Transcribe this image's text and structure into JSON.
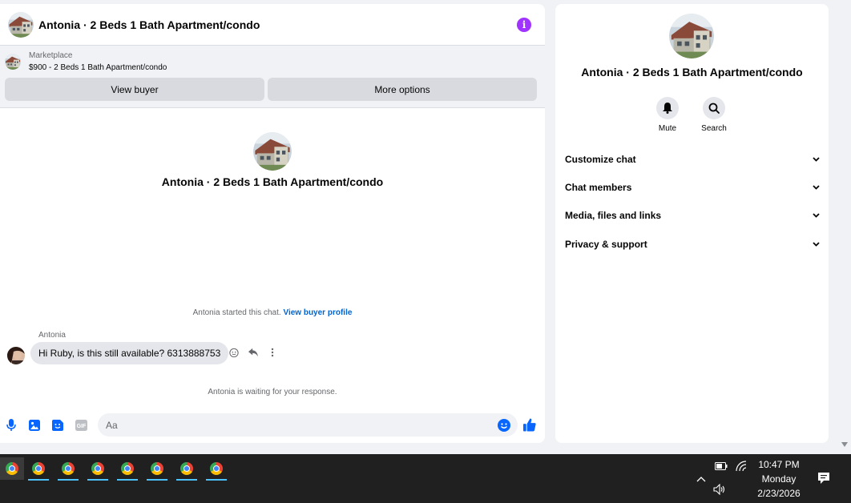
{
  "chat": {
    "title": "Antonia · 2 Beds 1 Bath Apartment/condo",
    "info_glyph": "i",
    "marketplace_label": "Marketplace",
    "listing": "$900 - 2 Beds 1 Bath Apartment/condo",
    "view_buyer_label": "View buyer",
    "more_options_label": "More options",
    "profile_name": "Antonia · 2 Beds 1 Bath Apartment/condo",
    "started_text": "Antonia started this chat.",
    "view_buyer_profile_link": "View buyer profile",
    "sender": "Antonia",
    "message": "Hi Ruby, is this still available? 6313888753",
    "waiting_text": "Antonia is waiting for your response.",
    "input_placeholder": "Aa"
  },
  "info_panel": {
    "name": "Antonia · 2 Beds 1 Bath Apartment/condo",
    "mute_label": "Mute",
    "search_label": "Search",
    "sections": [
      "Customize chat",
      "Chat members",
      "Media, files and links",
      "Privacy & support"
    ]
  },
  "taskbar": {
    "time": "10:47 PM",
    "day": "Monday",
    "date": "2/23/2026"
  },
  "colors": {
    "accent": "#0866ff",
    "info_purple": "#a033ff",
    "link": "#0064d1",
    "taskbar_bg": "#202020"
  }
}
